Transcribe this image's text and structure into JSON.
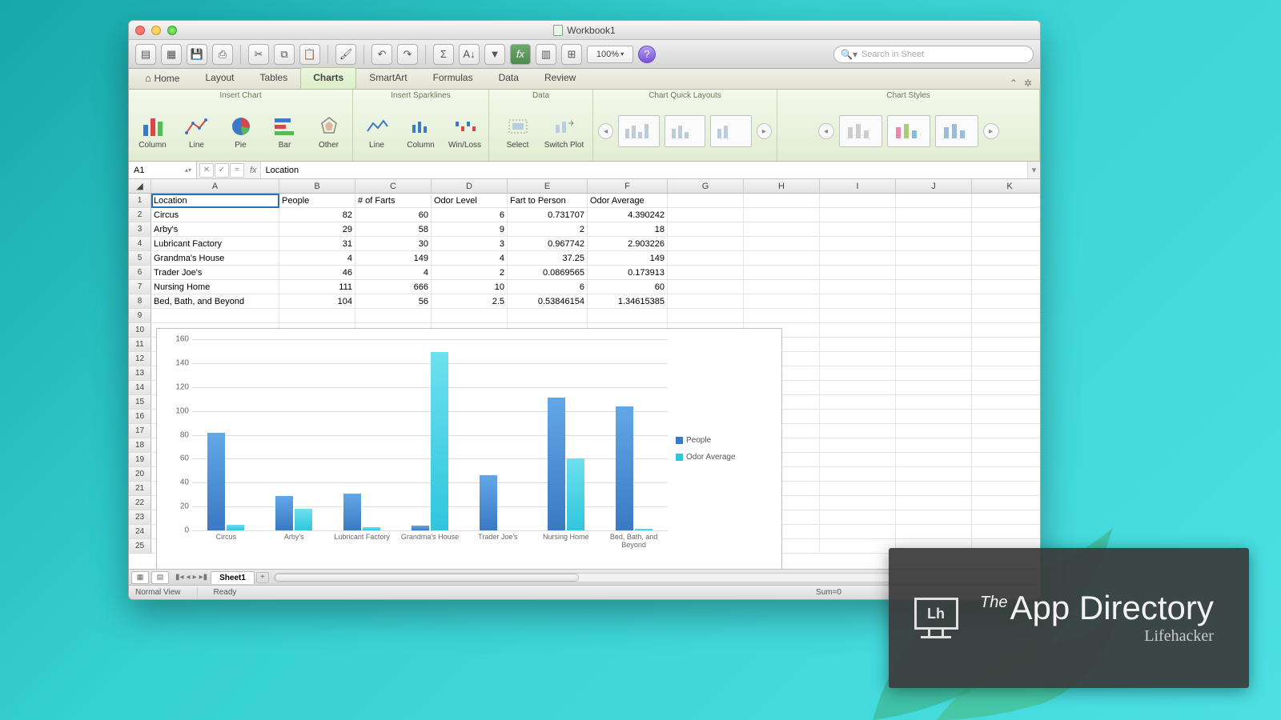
{
  "titlebar": {
    "title": "Workbook1"
  },
  "toolbar": {
    "zoom": "100%",
    "search_placeholder": "Search in Sheet"
  },
  "ribbon_tabs": [
    "Home",
    "Layout",
    "Tables",
    "Charts",
    "SmartArt",
    "Formulas",
    "Data",
    "Review"
  ],
  "active_tab": "Charts",
  "ribbon_groups": {
    "insert_chart": {
      "title": "Insert Chart",
      "items": [
        "Column",
        "Line",
        "Pie",
        "Bar",
        "Other"
      ]
    },
    "sparklines": {
      "title": "Insert Sparklines",
      "items": [
        "Line",
        "Column",
        "Win/Loss"
      ]
    },
    "data": {
      "title": "Data",
      "items": [
        "Select",
        "Switch Plot"
      ]
    },
    "quick_layouts": {
      "title": "Chart Quick Layouts"
    },
    "styles": {
      "title": "Chart Styles"
    }
  },
  "formula": {
    "cell": "A1",
    "fx": "Location"
  },
  "columns": [
    "A",
    "B",
    "C",
    "D",
    "E",
    "F",
    "G",
    "H",
    "I",
    "J",
    "K"
  ],
  "headers": [
    "Location",
    "People",
    "# of Farts",
    "Odor Level",
    "Fart to Person",
    "Odor Average"
  ],
  "rows": [
    {
      "loc": "Circus",
      "people": "82",
      "farts": "60",
      "odor": "6",
      "ratio": "0.731707",
      "avg": "4.390242"
    },
    {
      "loc": "Arby's",
      "people": "29",
      "farts": "58",
      "odor": "9",
      "ratio": "2",
      "avg": "18"
    },
    {
      "loc": "Lubricant Factory",
      "people": "31",
      "farts": "30",
      "odor": "3",
      "ratio": "0.967742",
      "avg": "2.903226"
    },
    {
      "loc": "Grandma's House",
      "people": "4",
      "farts": "149",
      "odor": "4",
      "ratio": "37.25",
      "avg": "149"
    },
    {
      "loc": "Trader Joe's",
      "people": "46",
      "farts": "4",
      "odor": "2",
      "ratio": "0.0869565",
      "avg": "0.173913"
    },
    {
      "loc": "Nursing Home",
      "people": "111",
      "farts": "666",
      "odor": "10",
      "ratio": "6",
      "avg": "60"
    },
    {
      "loc": "Bed, Bath, and Beyond",
      "people": "104",
      "farts": "56",
      "odor": "2.5",
      "ratio": "0.53846154",
      "avg": "1.34615385"
    }
  ],
  "row_count": 25,
  "chart_data": {
    "type": "bar",
    "categories": [
      "Circus",
      "Arby's",
      "Lubricant Factory",
      "Grandma's House",
      "Trader Joe's",
      "Nursing Home",
      "Bed, Bath, and Beyond"
    ],
    "series": [
      {
        "name": "People",
        "values": [
          82,
          29,
          31,
          4,
          46,
          111,
          104
        ],
        "color": "#3a79c4"
      },
      {
        "name": "Odor Average",
        "values": [
          4.39,
          18,
          2.9,
          149,
          0.17,
          60,
          1.35
        ],
        "color": "#2fc6dd"
      }
    ],
    "ylim": [
      0,
      160
    ],
    "yticks": [
      0,
      20,
      40,
      60,
      80,
      100,
      120,
      140,
      160
    ]
  },
  "sheet_tab": "Sheet1",
  "status": {
    "view": "Normal View",
    "state": "Ready",
    "sum": "Sum=0"
  },
  "watermark": {
    "the": "The",
    "main": "App Directory",
    "sub": "Lifehacker",
    "logo": "Lh"
  }
}
